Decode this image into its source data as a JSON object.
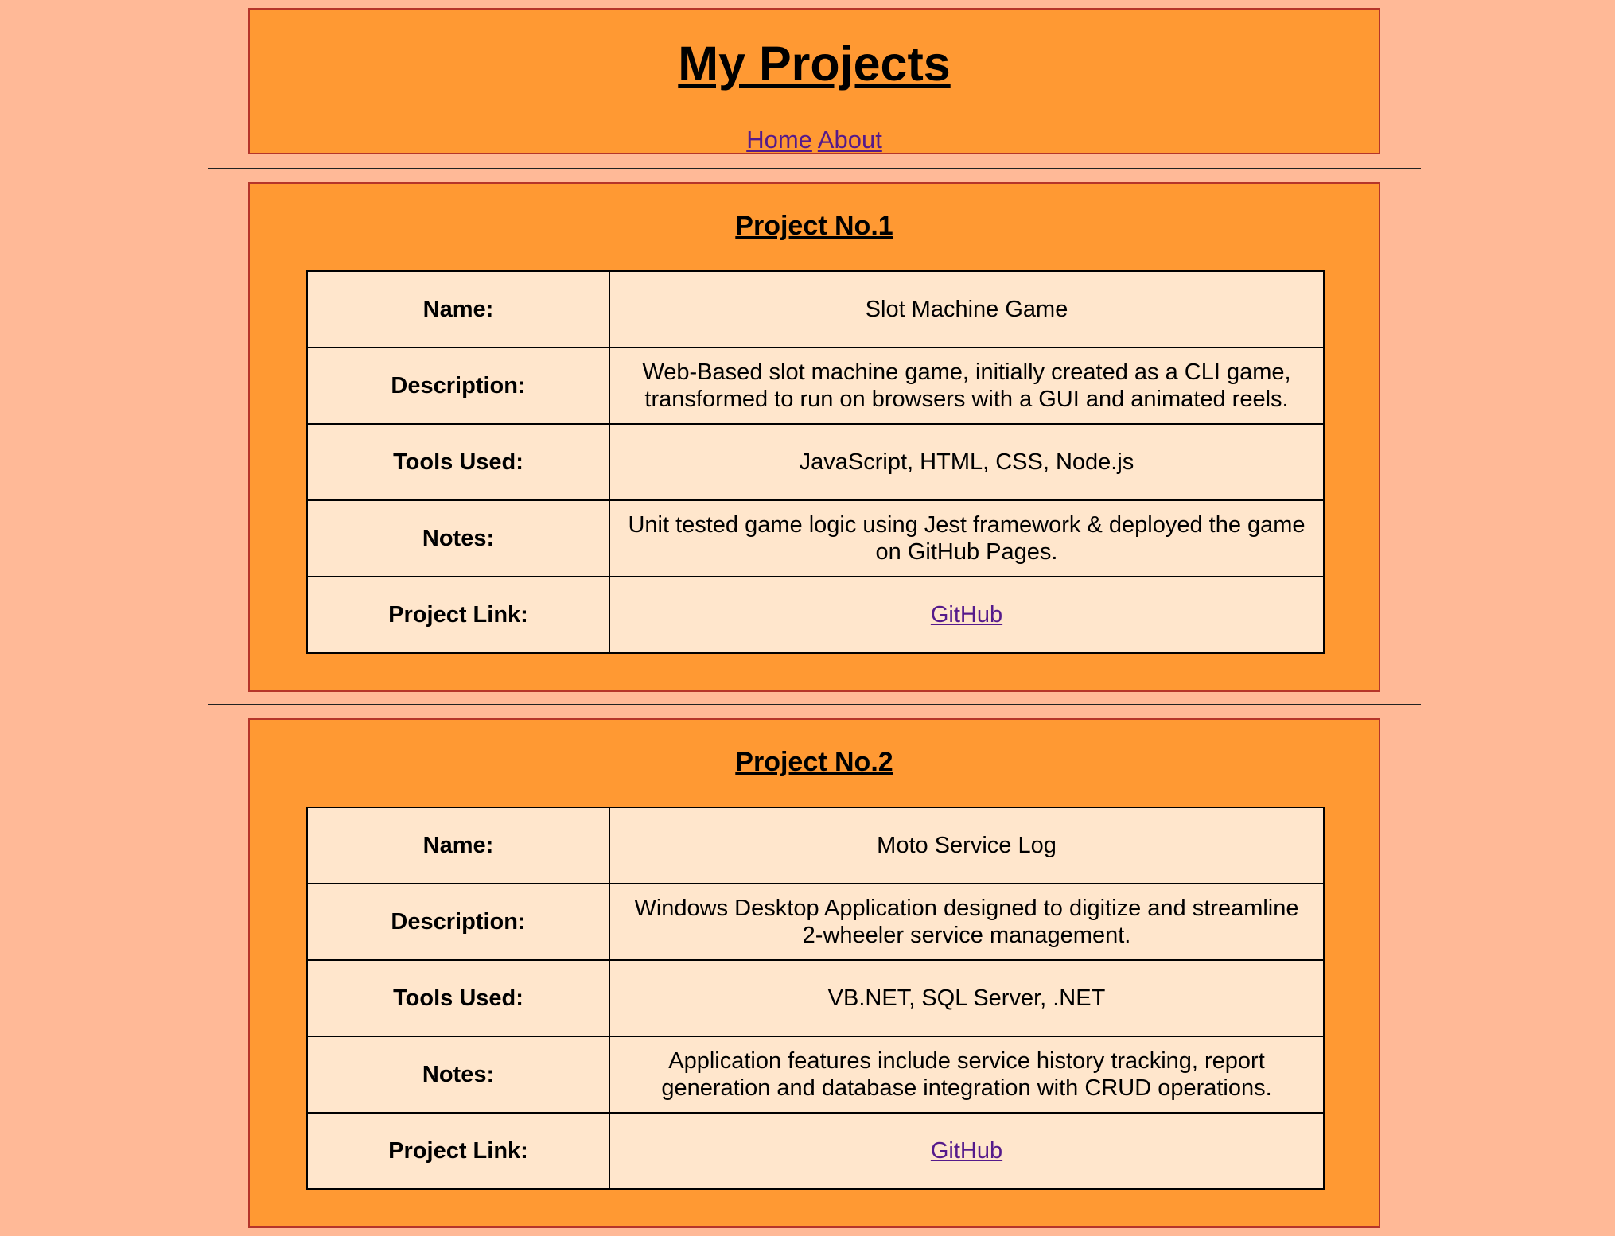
{
  "header": {
    "title": "My Projects",
    "nav": [
      {
        "label": "Home"
      },
      {
        "label": "About"
      }
    ]
  },
  "projects": [
    {
      "heading": "Project No.1",
      "rows": [
        {
          "label": "Name:",
          "value": "Slot Machine Game"
        },
        {
          "label": "Description:",
          "value": "Web-Based slot machine game, initially created as a CLI game, transformed to run on browsers with a GUI and animated reels."
        },
        {
          "label": "Tools Used:",
          "value": "JavaScript, HTML, CSS, Node.js"
        },
        {
          "label": "Notes:",
          "value": "Unit tested game logic using Jest framework & deployed the game on GitHub Pages."
        },
        {
          "label": "Project Link:",
          "value": "GitHub"
        }
      ]
    },
    {
      "heading": "Project No.2",
      "rows": [
        {
          "label": "Name:",
          "value": "Moto Service Log"
        },
        {
          "label": "Description:",
          "value": "Windows Desktop Application designed to digitize and streamline 2-wheeler service management."
        },
        {
          "label": "Tools Used:",
          "value": "VB.NET, SQL Server, .NET"
        },
        {
          "label": "Notes:",
          "value": "Application features include service history tracking, report generation and database integration with CRUD operations."
        },
        {
          "label": "Project Link:",
          "value": "GitHub"
        }
      ]
    }
  ],
  "colors": {
    "page_background": "#ffb997",
    "panel_background": "#ff9933",
    "panel_border": "#b5352a",
    "table_background": "#ffe6cc",
    "link": "#551a8b"
  }
}
